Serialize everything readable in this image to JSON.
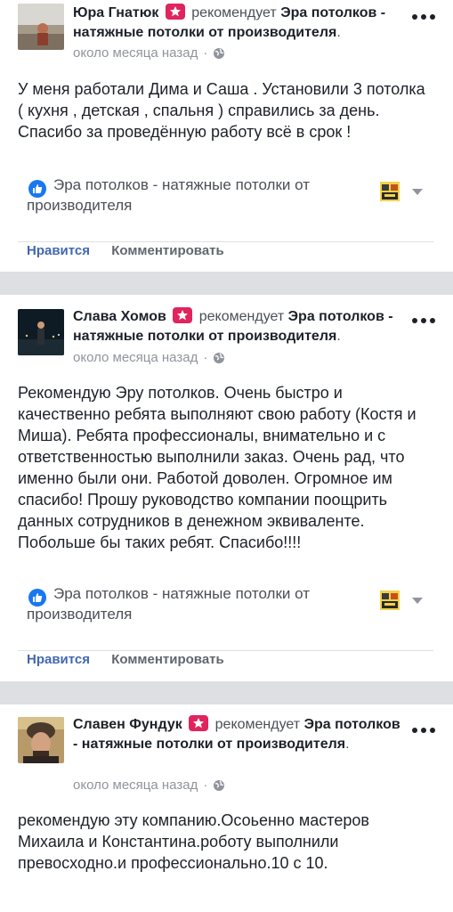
{
  "posts": [
    {
      "author": "Юра Гнатюк",
      "verb": "рекомендует",
      "page": "Эра потолков - натяжные потолки от производителя",
      "time": "около месяца назад",
      "text": "У меня работали Дима и Саша . Установили 3 потолка ( кухня , детская , спальня ) справились за день. Спасибо за проведённую работу всё в срок !",
      "link_title": "Эра потолков - натяжные потолки от производителя",
      "like_label": "Нравится",
      "comment_label": "Комментировать"
    },
    {
      "author": "Слава Хомов",
      "verb": "рекомендует",
      "page": "Эра потолков - натяжные потолки от производителя",
      "time": "около месяца назад",
      "text": "Рекомендую Эру потолков. Очень быстро и качественно ребята выполняют свою работу (Костя и Миша). Ребята профессионалы, внимательно и с ответственностью выполнили заказ. Очень рад, что именно были они. Работой доволен. Огромное им спасибо! Прошу руководство компании поощрить данных сотрудников в денежном эквиваленте. Побольше бы таких ребят. Спасибо!!!!",
      "link_title": "Эра потолков - натяжные потолки от производителя",
      "like_label": "Нравится",
      "comment_label": "Комментировать"
    },
    {
      "author": "Славен Фундук",
      "verb": "рекомендует",
      "page": "Эра потолков - натяжные потолки от производителя",
      "time": "около месяца назад",
      "text": "рекомендую эту компанию.Осоьенно мастеров Михаила и Константина.роботу выполнили превосходно.и профессионально.10 с 10."
    }
  ],
  "separator": "·",
  "icons": {
    "recommend": "star-badge-icon",
    "privacy": "globe-icon",
    "like": "thumbs-up-icon",
    "menu": "more-options-icon",
    "dropdown": "chevron-down-icon"
  },
  "colors": {
    "brand_blue": "#4267b2",
    "recommend_badge": "#e0245e",
    "like_icon": "#1877f2",
    "feed_gap": "#dddfe2"
  }
}
